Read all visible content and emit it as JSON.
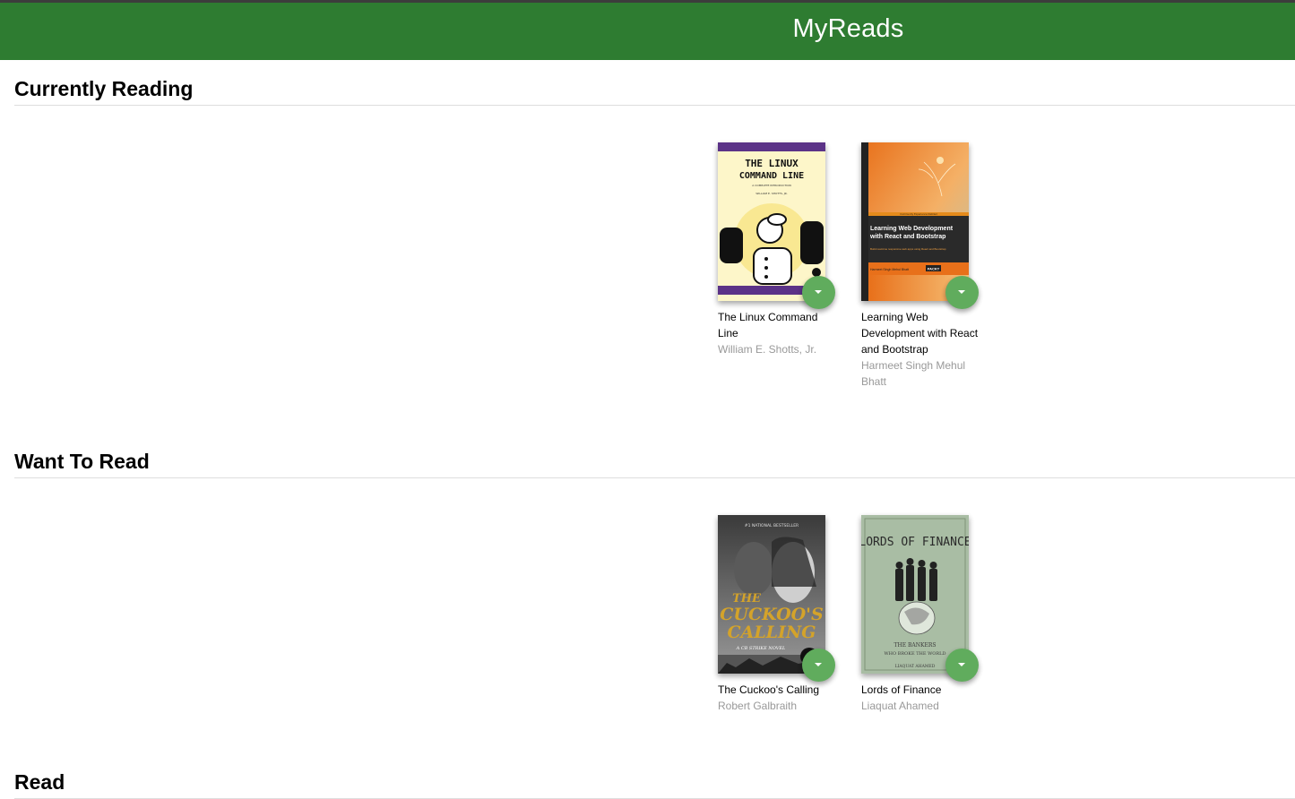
{
  "app": {
    "title": "MyReads"
  },
  "colors": {
    "header": "#2e7c31",
    "changer": "#60ac5d",
    "author": "#999999"
  },
  "shelves": [
    {
      "title": "Currently Reading",
      "books": [
        {
          "title": "The Linux Command Line",
          "authors": "William E. Shotts, Jr.",
          "cover": {
            "line1": "THE LINUX",
            "line2": "COMMAND LINE",
            "tagline": "A COMPLETE INTRODUCTION",
            "author": "WILLIAM E. SHOTTS, JR."
          },
          "shelf_menu_icon": "chevron-down-icon"
        },
        {
          "title": "Learning Web Development with React and Bootstrap",
          "authors": "Harmeet Singh Mehul Bhatt",
          "cover": {
            "series": "Community Experience Distilled",
            "line1": "Learning Web Development",
            "line2": "with React and Bootstrap",
            "tagline": "Build real-time responsive web apps using React and Bootstrap",
            "author": "Harmeet Singh  Mehul Bhatt",
            "publisher": "PACKT"
          },
          "shelf_menu_icon": "chevron-down-icon"
        }
      ]
    },
    {
      "title": "Want To Read",
      "books": [
        {
          "title": "The Cuckoo's Calling",
          "authors": "Robert Galbraith",
          "cover": {
            "banner": "#1 NATIONAL BESTSELLER",
            "line1": "THE",
            "line2": "CUCKOO'S",
            "line3": "CALLING",
            "tagline": "A CB STRIKE NOVEL"
          },
          "shelf_menu_icon": "chevron-down-icon"
        },
        {
          "title": "Lords of Finance",
          "authors": "Liaquat Ahamed",
          "cover": {
            "line1": "LORDS OF FINANCE",
            "tagline1": "THE BANKERS",
            "tagline2": "WHO BROKE THE WORLD",
            "author": "LIAQUAT AHAMED"
          },
          "shelf_menu_icon": "chevron-down-icon"
        }
      ]
    },
    {
      "title": "Read",
      "books": []
    }
  ]
}
